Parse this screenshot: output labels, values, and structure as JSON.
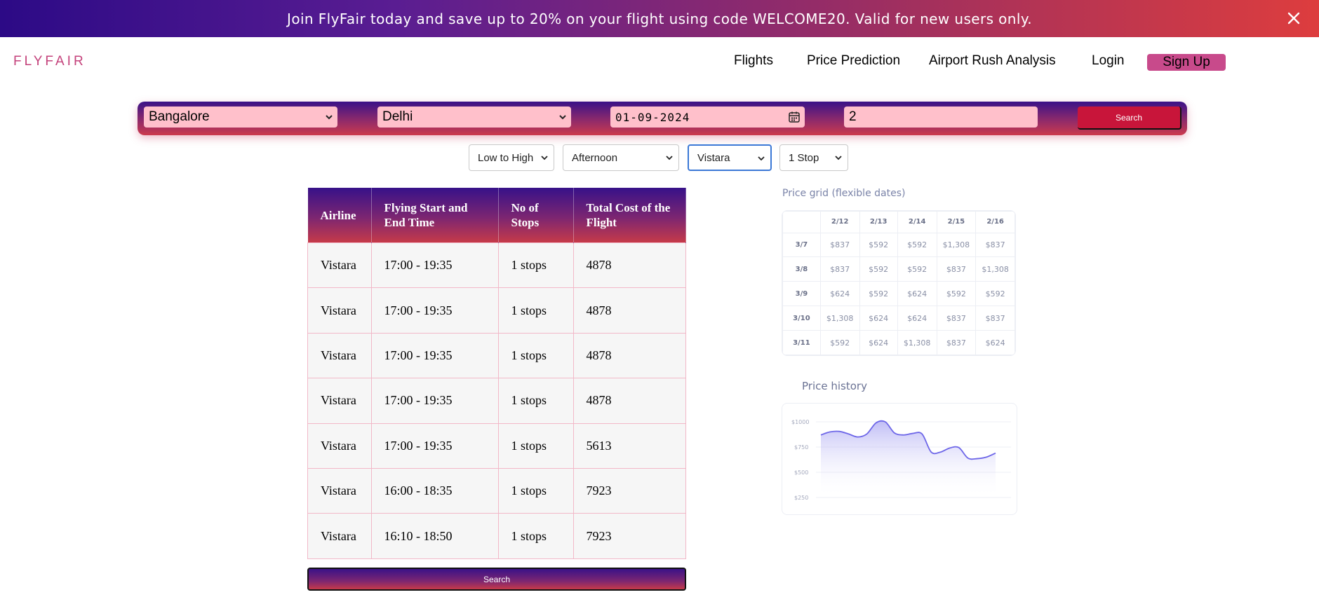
{
  "promo": {
    "text": "Join FlyFair today and save up to 20% on your flight using code WELCOME20. Valid for new users only.",
    "close_icon": "close-icon"
  },
  "nav": {
    "logo": "FLYFAIR",
    "flights": "Flights",
    "price_prediction": "Price Prediction",
    "airport_rush": "Airport Rush Analysis",
    "login": "Login",
    "signup": "Sign Up"
  },
  "search": {
    "from": "Bangalore",
    "to": "Delhi",
    "date": "01-09-2024",
    "passengers": "2",
    "button": "Search"
  },
  "filters": {
    "sort": "Low to High",
    "time": "Afternoon",
    "airline": "Vistara",
    "stops": "1 Stop"
  },
  "results": {
    "headers": [
      "Airline",
      "Flying Start and End Time",
      "No of Stops",
      "Total Cost of the Flight"
    ],
    "rows": [
      [
        "Vistara",
        "17:00 - 19:35",
        "1 stops",
        "4878"
      ],
      [
        "Vistara",
        "17:00 - 19:35",
        "1 stops",
        "4878"
      ],
      [
        "Vistara",
        "17:00 - 19:35",
        "1 stops",
        "4878"
      ],
      [
        "Vistara",
        "17:00 - 19:35",
        "1 stops",
        "4878"
      ],
      [
        "Vistara",
        "17:00 - 19:35",
        "1 stops",
        "5613"
      ],
      [
        "Vistara",
        "16:00 - 18:35",
        "1 stops",
        "7923"
      ],
      [
        "Vistara",
        "16:10 - 18:50",
        "1 stops",
        "7923"
      ]
    ],
    "button": "Search"
  },
  "price_grid": {
    "title": "Price grid (flexible dates)",
    "columns": [
      "2/12",
      "2/13",
      "2/14",
      "2/15",
      "2/16"
    ],
    "rows": [
      {
        "label": "3/7",
        "prices": [
          "$837",
          "$592",
          "$592",
          "$1,308",
          "$837"
        ]
      },
      {
        "label": "3/8",
        "prices": [
          "$837",
          "$592",
          "$592",
          "$837",
          "$1,308"
        ]
      },
      {
        "label": "3/9",
        "prices": [
          "$624",
          "$592",
          "$624",
          "$592",
          "$592"
        ]
      },
      {
        "label": "3/10",
        "prices": [
          "$1,308",
          "$624",
          "$624",
          "$837",
          "$837"
        ]
      },
      {
        "label": "3/11",
        "prices": [
          "$592",
          "$624",
          "$1,308",
          "$837",
          "$624"
        ]
      }
    ]
  },
  "price_history": {
    "title": "Price history",
    "chart_data": {
      "type": "area",
      "title": "Price history",
      "y_ticks": [
        "$1000",
        "$750",
        "$500",
        "$250"
      ],
      "ylim": [
        250,
        1000
      ],
      "values": [
        870,
        900,
        905,
        880,
        850,
        880,
        990,
        1000,
        890,
        870,
        885,
        880,
        700,
        700,
        740,
        745,
        640,
        635,
        650,
        690
      ],
      "color": "#6d66e8",
      "grid": true
    }
  },
  "colors": {
    "brand_pink": "#c4427b",
    "search_red": "#c8153a",
    "field_pink": "#ffc0cb"
  }
}
